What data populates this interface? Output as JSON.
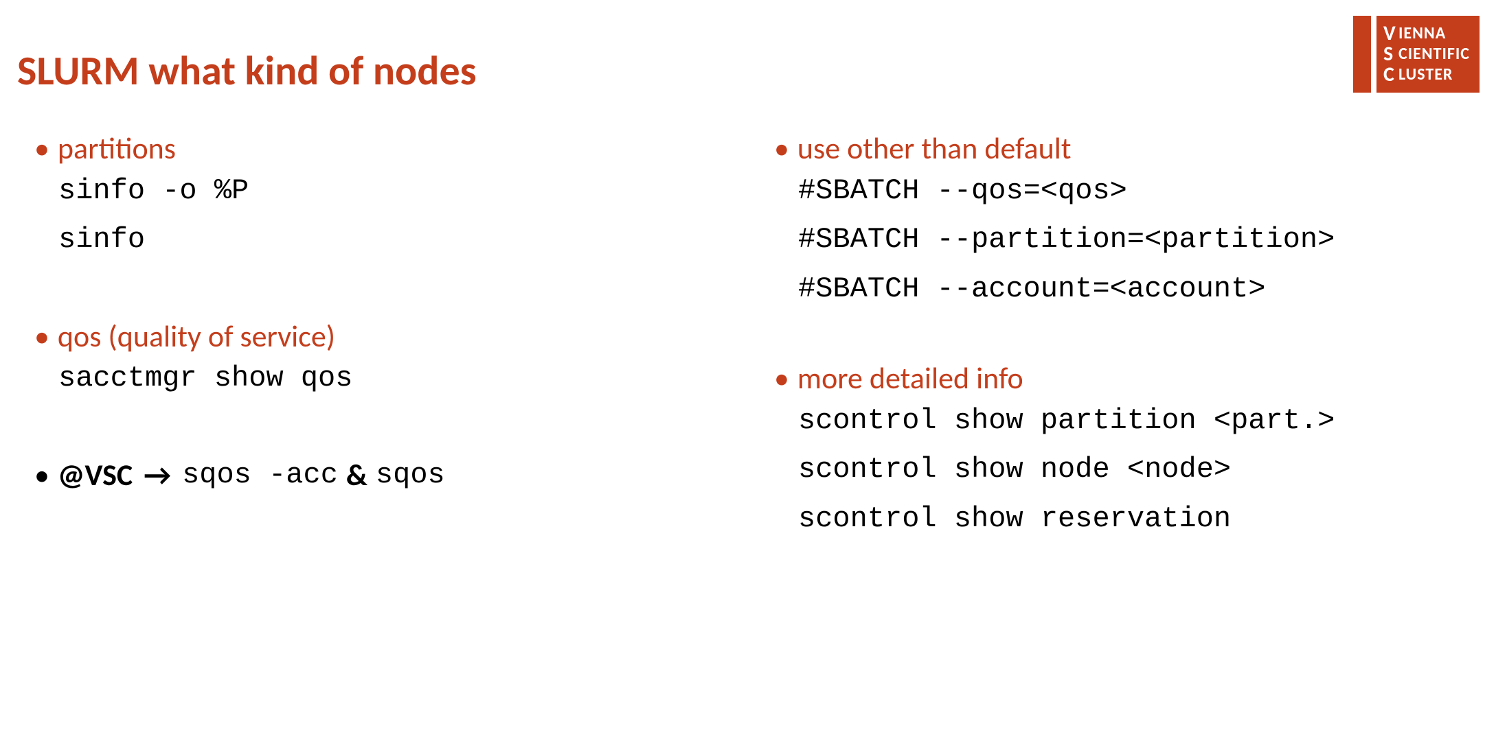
{
  "logo": {
    "line1_letter": "V",
    "line1_rest": "IENNA",
    "line2_letter": "S",
    "line2_rest": "CIENTIFIC",
    "line3_letter": "C",
    "line3_rest": "LUSTER"
  },
  "slide": {
    "title": "SLURM what kind of nodes"
  },
  "left": {
    "partitions": {
      "heading": "partitions",
      "cmd1": "sinfo -o %P",
      "cmd2": "sinfo"
    },
    "qos": {
      "heading": "qos (quality of service)",
      "cmd1": "sacctmgr show qos"
    },
    "atvsc": {
      "prefix": "@VSC",
      "arrow": "→",
      "cmd1": "sqos -acc",
      "amp": "&",
      "cmd2": "sqos"
    }
  },
  "right": {
    "other": {
      "heading": "use other than default",
      "cmd1": "#SBATCH --qos=<qos>",
      "cmd2": "#SBATCH --partition=<partition>",
      "cmd3": "#SBATCH --account=<account>"
    },
    "detail": {
      "heading": "more detailed info",
      "cmd1": "scontrol show partition <part.>",
      "cmd2": "scontrol show node <node>",
      "cmd3": "scontrol show reservation"
    }
  }
}
